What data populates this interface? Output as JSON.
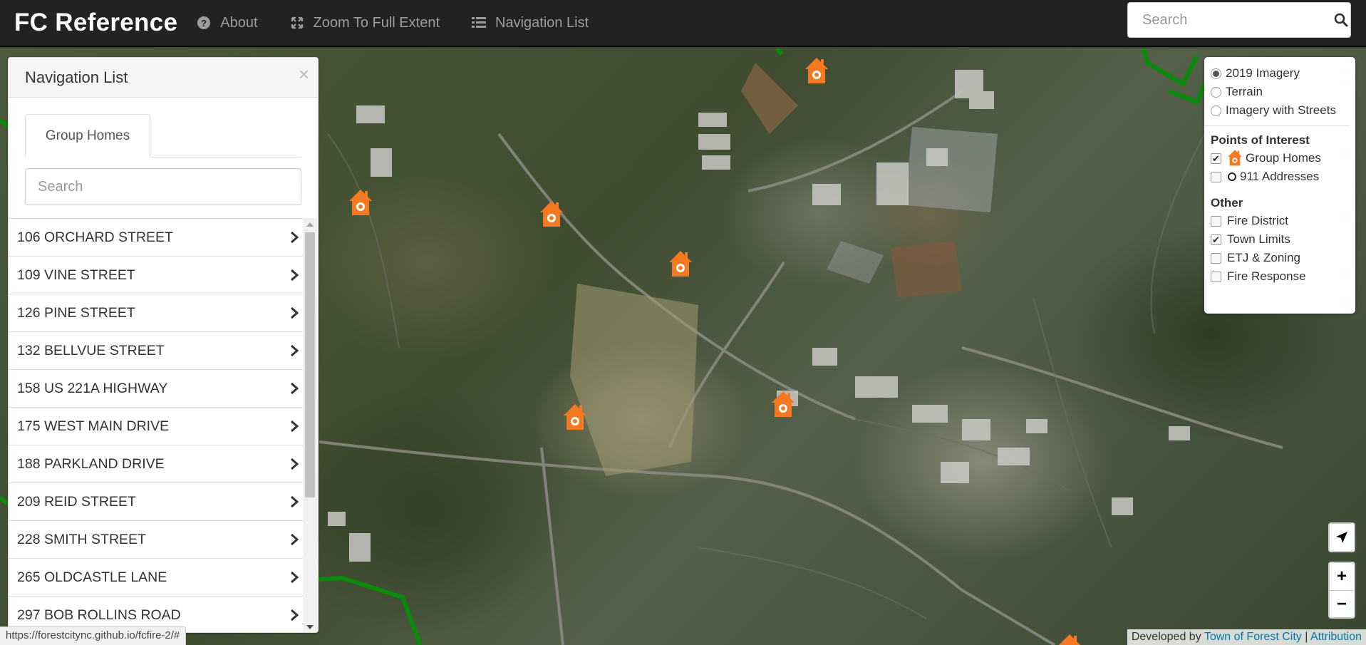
{
  "navbar": {
    "brand": "FC Reference",
    "links": [
      {
        "label": "About",
        "icon": "question-circle-icon"
      },
      {
        "label": "Zoom To Full Extent",
        "icon": "fullscreen-icon"
      },
      {
        "label": "Navigation List",
        "icon": "list-icon"
      }
    ],
    "search_placeholder": "Search"
  },
  "sidebar": {
    "title": "Navigation List",
    "close": "×",
    "tab": "Group Homes",
    "search_placeholder": "Search",
    "items": [
      "106 ORCHARD STREET",
      "109 VINE STREET",
      "126 PINE STREET",
      "132 BELLVUE STREET",
      "158 US 221A HIGHWAY",
      "175 WEST MAIN DRIVE",
      "188 PARKLAND DRIVE",
      "209 REID STREET",
      "228 SMITH STREET",
      "265 OLDCASTLE LANE",
      "297 BOB ROLLINS ROAD"
    ]
  },
  "layers": {
    "basemaps": [
      {
        "label": "2019 Imagery",
        "selected": true
      },
      {
        "label": "Terrain",
        "selected": false
      },
      {
        "label": "Imagery with Streets",
        "selected": false
      }
    ],
    "poi_title": "Points of Interest",
    "poi": [
      {
        "label": "Group Homes",
        "checked": true,
        "icon": "group-home-icon"
      },
      {
        "label": "911 Addresses",
        "checked": false,
        "icon": "circle-outline-icon"
      }
    ],
    "other_title": "Other",
    "other": [
      {
        "label": "Fire District",
        "checked": false
      },
      {
        "label": "Town Limits",
        "checked": true
      },
      {
        "label": "ETJ & Zoning",
        "checked": false
      },
      {
        "label": "Fire Response",
        "checked": false
      }
    ]
  },
  "controls": {
    "zoom_in": "+",
    "zoom_out": "−"
  },
  "attribution": {
    "prefix": "Developed by",
    "org": "Town of Forest City",
    "divider": "|",
    "attribution": "Attribution"
  },
  "status_url": "https://forestcitync.github.io/fcfire-2/#",
  "colors": {
    "navbar_bg": "#222222",
    "marker": "#f47920",
    "town_limits": "#0a8a0a",
    "link": "#0078a8"
  }
}
